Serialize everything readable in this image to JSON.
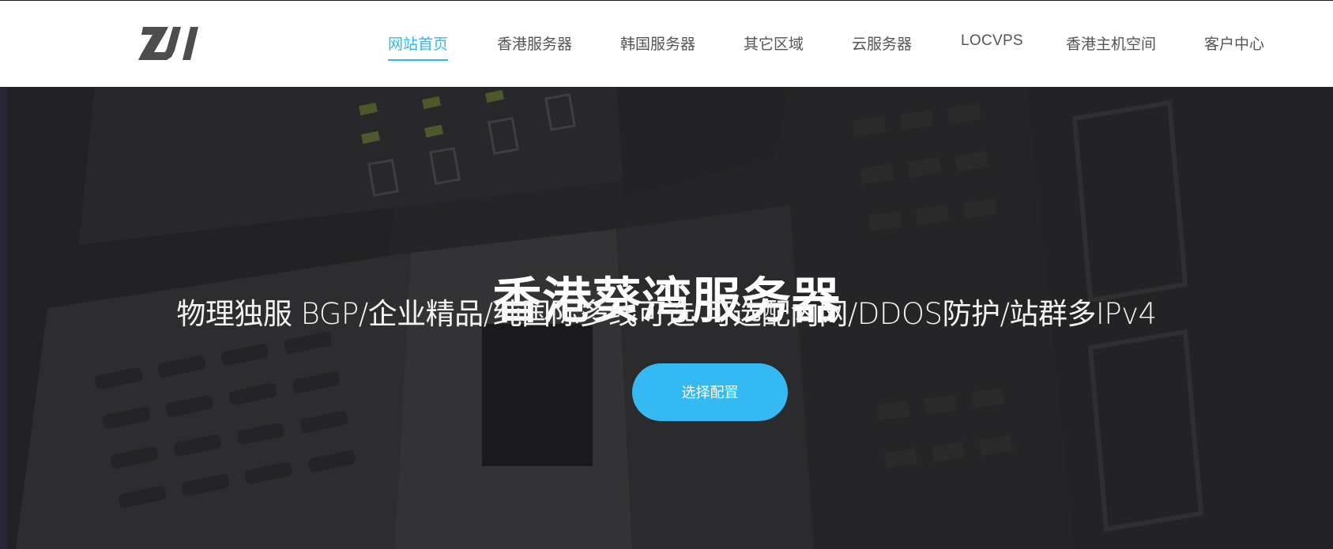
{
  "brand": {
    "logo_text": "ZJI",
    "logo_color": "#4a4a4a"
  },
  "nav": {
    "items": [
      {
        "label": "网站首页",
        "active": true
      },
      {
        "label": "香港服务器",
        "active": false
      },
      {
        "label": "韩国服务器",
        "active": false
      },
      {
        "label": "其它区域",
        "active": false
      },
      {
        "label": "云服务器",
        "active": false
      },
      {
        "label": "LOCVPS",
        "active": false
      },
      {
        "label": "香港主机空间",
        "active": false
      },
      {
        "label": "客户中心",
        "active": false
      }
    ],
    "active_color": "#2fb9f0",
    "text_color": "#555555"
  },
  "hero": {
    "title": "香港葵湾服务器",
    "subtitle": "物理独服 BGP/企业精品/纯国际多线可选 可选配内网/DDOS防护/站群多IPv4",
    "cta_label": "选择配置",
    "cta_color": "#35b9f2"
  }
}
